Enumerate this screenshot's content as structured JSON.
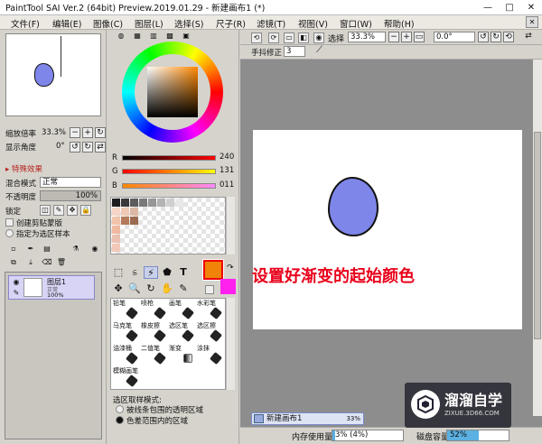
{
  "window": {
    "title": "PaintTool SAI Ver.2 (64bit) Preview.2019.01.29 - 新建画布1 (*)",
    "minimize": "—",
    "maximize": "□",
    "close": "✕"
  },
  "menu": [
    "文件(F)",
    "编辑(E)",
    "图像(C)",
    "图层(L)",
    "选择(S)",
    "尺子(R)",
    "滤镜(T)",
    "视图(V)",
    "窗口(W)",
    "帮助(H)"
  ],
  "navigator": {
    "zoom_label": "缩放倍率",
    "zoom_value": "33.3%",
    "angle_label": "显示角度",
    "angle_value": "0°"
  },
  "layer_panel": {
    "special_effects": "▸ 特殊效果",
    "blend_label": "混合模式",
    "blend_value": "正常",
    "opacity_label": "不透明度",
    "opacity_value": "100%",
    "lock_label": "锁定",
    "clip_label": "创建剪贴蒙版",
    "select_source_label": "指定为选区样本",
    "layer": {
      "name": "图层1",
      "mode": "正常",
      "opacity": "100%"
    }
  },
  "color": {
    "r_label": "R",
    "r_value": "240",
    "g_label": "G",
    "g_value": "131",
    "b_label": "B",
    "b_value": "011",
    "primary": "#f08308",
    "secondary": "#ff22ee"
  },
  "tools": {
    "text_tool": "T",
    "brushes": [
      "铅笔",
      "喷枪",
      "画笔",
      "水彩笔",
      "马克笔",
      "橡皮擦",
      "选区笔",
      "选区擦",
      "油漆桶",
      "二值笔",
      "渐变",
      "涂抹",
      "模糊画笔"
    ],
    "selection_mode_label": "选区取样模式:",
    "option1": "被线条包围的透明区域",
    "option2": "色差范围内的区域"
  },
  "canvas_toolbar": {
    "select_label": "选择",
    "zoom_value": "33.3%",
    "angle_value": "0.0°",
    "stabilizer_label": "手抖修正",
    "stabilizer_value": "3"
  },
  "canvas_tab": {
    "name": "新建画布1",
    "zoom": "33%"
  },
  "status": {
    "memory_label": "内存使用量",
    "memory_value": "3% (4%)",
    "disk_label": "磁盘容量",
    "disk_value": "52%"
  },
  "annotation": "设置好渐变的起始颜色",
  "watermark": {
    "title": "溜溜自学",
    "url": "ZIXUE.3D66.COM"
  }
}
